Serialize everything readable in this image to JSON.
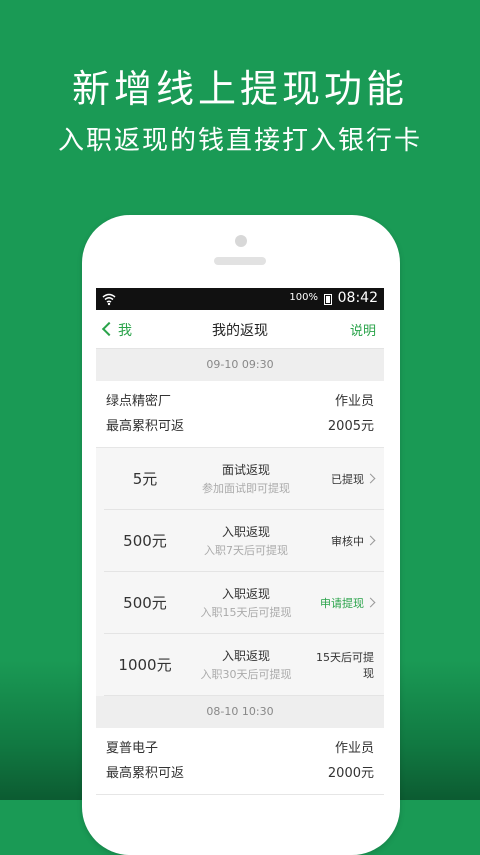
{
  "hero": {
    "title": "新增线上提现功能",
    "subtitle": "入职返现的钱直接打入银行卡"
  },
  "statusbar": {
    "battery": "100%",
    "time": "08:42",
    "icons": [
      "wifi-icon",
      "battery-icon"
    ]
  },
  "navbar": {
    "back_label": "我",
    "title": "我的返现",
    "help_label": "说明"
  },
  "groups": [
    {
      "date": "09-10 09:30",
      "company": "绿点精密厂",
      "role": "作业员",
      "max_label": "最高累积可返",
      "max_value": "2005元",
      "items": [
        {
          "amount": "5元",
          "title": "面试返现",
          "subtitle": "参加面试即可提现",
          "status": "已提现"
        },
        {
          "amount": "500元",
          "title": "入职返现",
          "subtitle": "入职7天后可提现",
          "status": "审核中"
        },
        {
          "amount": "500元",
          "title": "入职返现",
          "subtitle": "入职15天后可提现",
          "status": "申请提现"
        },
        {
          "amount": "1000元",
          "title": "入职返现",
          "subtitle": "入职30天后可提现",
          "status": "15天后可提现"
        }
      ]
    },
    {
      "date": "08-10 10:30",
      "company": "夏普电子",
      "role": "作业员",
      "max_label": "最高累积可返",
      "max_value": "2000元"
    }
  ],
  "colors": {
    "background": "#1a9a55",
    "accent_green": "#2aa34a"
  }
}
